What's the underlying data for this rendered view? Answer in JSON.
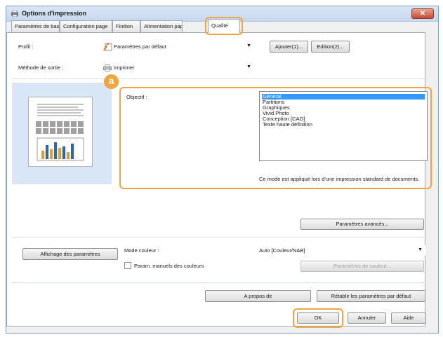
{
  "window": {
    "title": "Options d'impression",
    "close_label": "✕"
  },
  "tabs": [
    {
      "label": "Paramètres de base"
    },
    {
      "label": "Configuration page"
    },
    {
      "label": "Finition"
    },
    {
      "label": "Alimentation papier"
    },
    {
      "label": "Qualité"
    }
  ],
  "profile": {
    "label": "Profil :",
    "value": "Paramètres par défaut",
    "add_button": "Ajouter(1)...",
    "edit_button": "Edition(2)..."
  },
  "output_method": {
    "label": "Méthode de sortie :",
    "value": "Imprimer"
  },
  "marker": {
    "text": "a"
  },
  "objective": {
    "label": "Objectif :",
    "items": [
      "Général",
      "Partitions",
      "Graphiques",
      "Vivid Photo",
      "Conception [CAO]",
      "Texte haute définition"
    ],
    "selected_index": 0,
    "description": "Ce mode est appliqué lors d'une impression standard de documents."
  },
  "advanced_button": "Paramètres avancés...",
  "show_settings_button": "Affichage des paramètres",
  "color_mode": {
    "label": "Mode couleur :",
    "value": "Auto [Couleur/N&B]",
    "manual_checkbox_label": "Param. manuels des couleurs",
    "manual_checked": false,
    "color_settings_button": "Paramètres de couleur..."
  },
  "about_button": "A propos de",
  "restore_defaults_button": "Rétablir les paramètres par défaut",
  "ok_button": "OK",
  "cancel_button": "Annuler",
  "help_button": "Aide",
  "colors": {
    "accent_highlight": "#f0a640",
    "selection": "#3399ff"
  }
}
